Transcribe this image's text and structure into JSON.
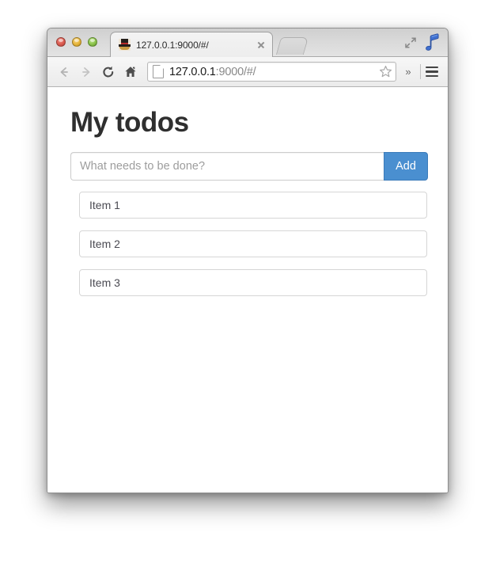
{
  "browser": {
    "tab": {
      "title": "127.0.0.1:9000/#/",
      "favicon_name": "mustache-hat-favicon",
      "close_label": "×"
    },
    "new_tab_label": "+",
    "window_controls": {
      "close_label": "close",
      "minimize_label": "minimize",
      "zoom_label": "zoom",
      "fullscreen_label": "fullscreen-arrows",
      "extension_label": "music-note-extension"
    },
    "toolbar": {
      "back_label": "Back",
      "forward_label": "Forward",
      "reload_label": "Reload",
      "home_label": "Home",
      "url_host": "127.0.0.1",
      "url_rest": ":9000/#/",
      "url_full": "127.0.0.1:9000/#/",
      "bookmark_label": "Bookmark this page",
      "overflow_label": "»",
      "menu_label": "Customize and control Google Chrome"
    }
  },
  "page": {
    "title": "My todos",
    "form": {
      "input_value": "",
      "input_placeholder": "What needs to be done?",
      "add_label": "Add",
      "add_color": "#4a8fd0"
    },
    "todos": [
      {
        "label": "Item 1"
      },
      {
        "label": "Item 2"
      },
      {
        "label": "Item 3"
      }
    ]
  }
}
